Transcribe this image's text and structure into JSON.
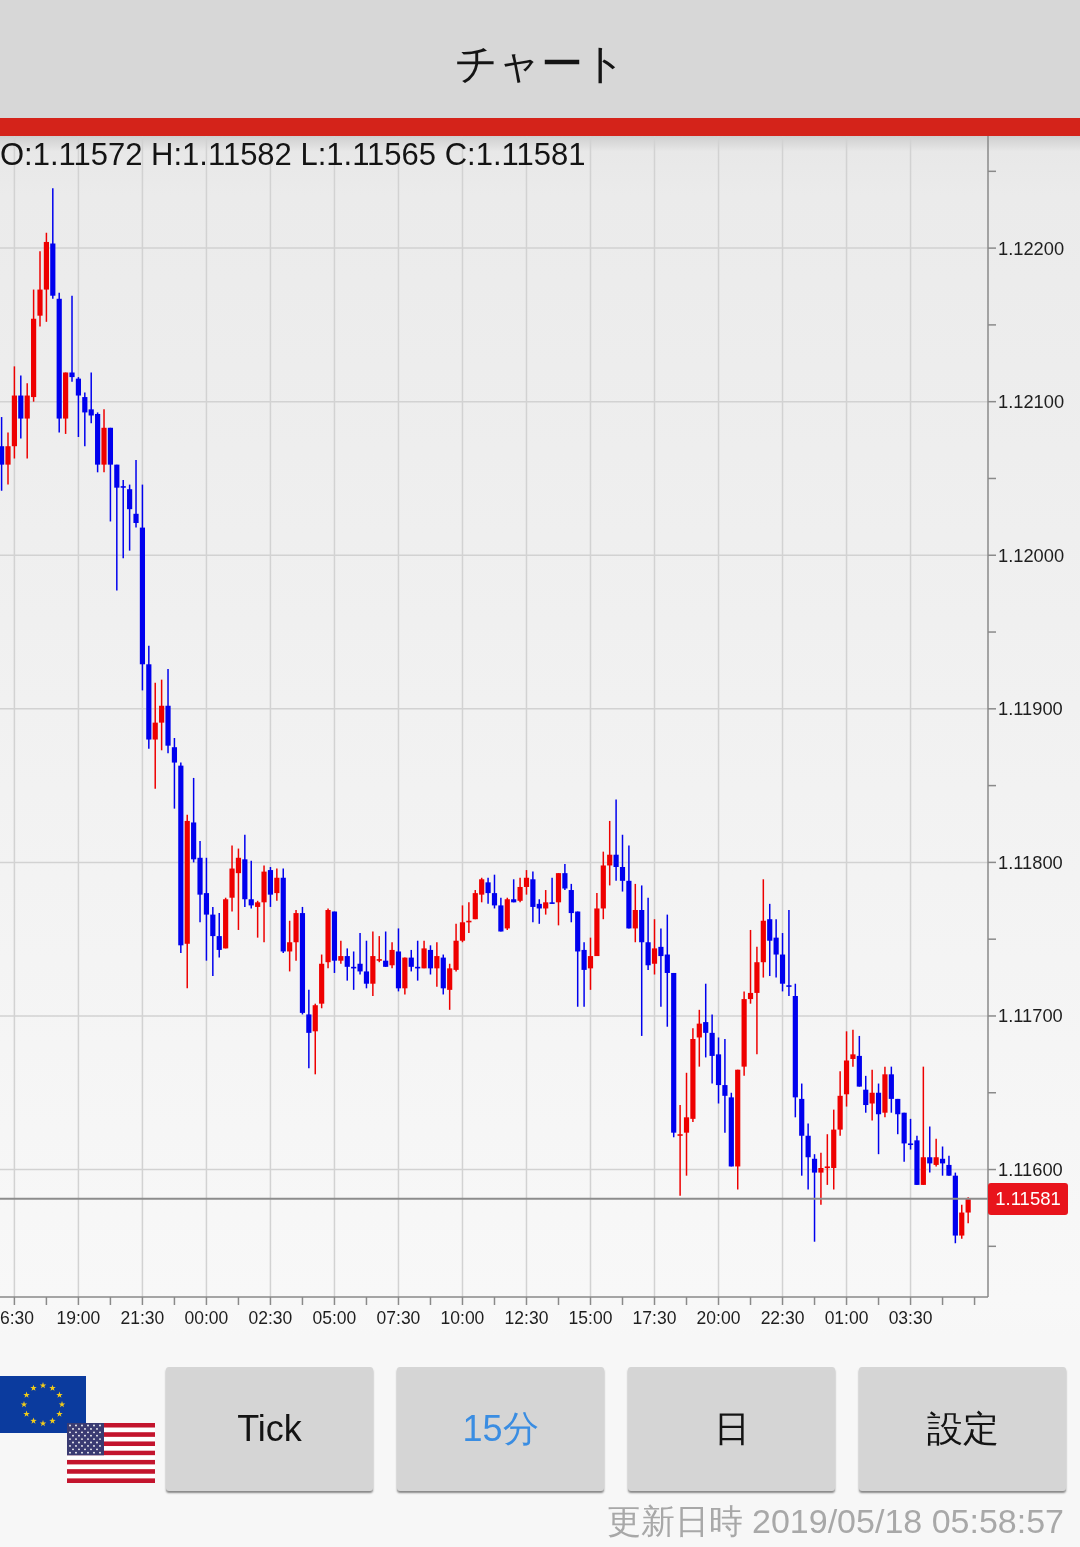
{
  "header": {
    "title": "チャート"
  },
  "chart": {
    "ohlc_readout": "O:1.11572 H:1.11582 L:1.11565 C:1.11581",
    "chart_data": {
      "type": "candlestick",
      "grid": true,
      "categories": [
        null,
        null,
        "6:30",
        null,
        null,
        null,
        null,
        null,
        null,
        null,
        null,
        null,
        "19:00",
        null,
        null,
        null,
        null,
        null,
        null,
        null,
        null,
        null,
        "21:30",
        null,
        null,
        null,
        null,
        null,
        null,
        null,
        null,
        null,
        "00:00",
        null,
        null,
        null,
        null,
        null,
        null,
        null,
        null,
        null,
        "02:30",
        null,
        null,
        null,
        null,
        null,
        null,
        null,
        null,
        null,
        "05:00",
        null,
        null,
        null,
        null,
        null,
        null,
        null,
        null,
        null,
        "07:30",
        null,
        null,
        null,
        null,
        null,
        null,
        null,
        null,
        null,
        "10:00",
        null,
        null,
        null,
        null,
        null,
        null,
        null,
        null,
        null,
        "12:30",
        null,
        null,
        null,
        null,
        null,
        null,
        null,
        null,
        null,
        "15:00",
        null,
        null,
        null,
        null,
        null,
        null,
        null,
        null,
        null,
        "17:30",
        null,
        null,
        null,
        null,
        null,
        null,
        null,
        null,
        null,
        "20:00",
        null,
        null,
        null,
        null,
        null,
        null,
        null,
        null,
        null,
        "22:30",
        null,
        null,
        null,
        null,
        null,
        null,
        null,
        null,
        null,
        "01:00",
        null,
        null,
        null,
        null,
        null,
        null,
        null,
        null,
        null,
        "03:30",
        null,
        null,
        null,
        null,
        null,
        null,
        null,
        null,
        null
      ],
      "ohlc": [
        [
          1.12071,
          1.1209,
          1.12042,
          1.12059
        ],
        [
          1.12059,
          1.1208,
          1.12046,
          1.12071
        ],
        [
          1.12071,
          1.12123,
          1.12063,
          1.12104
        ],
        [
          1.12104,
          1.12117,
          1.12076,
          1.12089
        ],
        [
          1.12089,
          1.12112,
          1.12063,
          1.12104
        ],
        [
          1.12103,
          1.12173,
          1.121,
          1.12154
        ],
        [
          1.12156,
          1.12198,
          1.12149,
          1.12173
        ],
        [
          1.12173,
          1.1221,
          1.12152,
          1.12204
        ],
        [
          1.12203,
          1.12239,
          1.12167,
          1.12169
        ],
        [
          1.12167,
          1.12171,
          1.1208,
          1.12089
        ],
        [
          1.12089,
          1.12119,
          1.12079,
          1.12119
        ],
        [
          1.12119,
          1.12169,
          1.12113,
          1.12116
        ],
        [
          1.12115,
          1.12116,
          1.12077,
          1.12104
        ],
        [
          1.12103,
          1.12106,
          1.12071,
          1.12093
        ],
        [
          1.12095,
          1.12119,
          1.12086,
          1.12091
        ],
        [
          1.12092,
          1.12093,
          1.12054,
          1.12059
        ],
        [
          1.12059,
          1.12095,
          1.12054,
          1.12083
        ],
        [
          1.12083,
          1.12083,
          1.12022,
          1.12059
        ],
        [
          1.12059,
          1.12059,
          1.11977,
          1.12044
        ],
        [
          1.12045,
          1.12049,
          1.11998,
          1.12044
        ],
        [
          1.12043,
          1.12046,
          1.12003,
          1.1203
        ],
        [
          1.12027,
          1.12062,
          1.12018,
          1.12021
        ],
        [
          1.12018,
          1.12046,
          1.11912,
          1.11929
        ],
        [
          1.11929,
          1.11941,
          1.11874,
          1.1188
        ],
        [
          1.1188,
          1.11917,
          1.11848,
          1.11891
        ],
        [
          1.11891,
          1.11919,
          1.11873,
          1.11902
        ],
        [
          1.11902,
          1.11926,
          1.11871,
          1.11876
        ],
        [
          1.11875,
          1.11881,
          1.11835,
          1.11865
        ],
        [
          1.11863,
          1.11865,
          1.11741,
          1.11746
        ],
        [
          1.11747,
          1.11831,
          1.11718,
          1.11827
        ],
        [
          1.11826,
          1.11855,
          1.118,
          1.11802
        ],
        [
          1.11803,
          1.11814,
          1.11761,
          1.11779
        ],
        [
          1.1178,
          1.11803,
          1.11736,
          1.11766
        ],
        [
          1.11766,
          1.11771,
          1.11726,
          1.11752
        ],
        [
          1.11752,
          1.11767,
          1.11738,
          1.11743
        ],
        [
          1.11744,
          1.11777,
          1.11744,
          1.11776
        ],
        [
          1.11777,
          1.11811,
          1.11768,
          1.11796
        ],
        [
          1.11793,
          1.11809,
          1.11756,
          1.11803
        ],
        [
          1.11802,
          1.11818,
          1.11771,
          1.11776
        ],
        [
          1.11776,
          1.11801,
          1.1177,
          1.11772
        ],
        [
          1.11771,
          1.11775,
          1.11751,
          1.11774
        ],
        [
          1.11774,
          1.11798,
          1.11748,
          1.11794
        ],
        [
          1.11795,
          1.11797,
          1.11771,
          1.11779
        ],
        [
          1.1178,
          1.11796,
          1.11775,
          1.1179
        ],
        [
          1.1179,
          1.11796,
          1.11741,
          1.11742
        ],
        [
          1.11742,
          1.11762,
          1.11729,
          1.11748
        ],
        [
          1.11748,
          1.11769,
          1.11736,
          1.11767
        ],
        [
          1.11767,
          1.11771,
          1.11701,
          1.11702
        ],
        [
          1.11701,
          1.11717,
          1.11666,
          1.11689
        ],
        [
          1.1169,
          1.11708,
          1.11662,
          1.11707
        ],
        [
          1.11708,
          1.1174,
          1.11705,
          1.11734
        ],
        [
          1.11735,
          1.1177,
          1.11731,
          1.11769
        ],
        [
          1.11768,
          1.11768,
          1.11728,
          1.11736
        ],
        [
          1.11736,
          1.11749,
          1.11734,
          1.11739
        ],
        [
          1.11739,
          1.11744,
          1.11723,
          1.11732
        ],
        [
          1.11732,
          1.11742,
          1.11717,
          1.11731
        ],
        [
          1.11734,
          1.11754,
          1.11727,
          1.11729
        ],
        [
          1.11729,
          1.11749,
          1.11718,
          1.11721
        ],
        [
          1.11721,
          1.11755,
          1.11713,
          1.11739
        ],
        [
          1.11736,
          1.11752,
          1.11735,
          1.11737
        ],
        [
          1.11736,
          1.11755,
          1.11732,
          1.11732
        ],
        [
          1.11733,
          1.11748,
          1.11731,
          1.11743
        ],
        [
          1.11742,
          1.11757,
          1.11716,
          1.11718
        ],
        [
          1.11718,
          1.11738,
          1.11714,
          1.11738
        ],
        [
          1.11738,
          1.11743,
          1.11729,
          1.11732
        ],
        [
          1.11732,
          1.11749,
          1.11723,
          1.11731
        ],
        [
          1.11731,
          1.11749,
          1.11731,
          1.11744
        ],
        [
          1.11743,
          1.11746,
          1.11727,
          1.11731
        ],
        [
          1.11731,
          1.11748,
          1.11719,
          1.11739
        ],
        [
          1.11738,
          1.1174,
          1.11714,
          1.11718
        ],
        [
          1.11717,
          1.11734,
          1.11704,
          1.11731
        ],
        [
          1.1173,
          1.1176,
          1.11729,
          1.11749
        ],
        [
          1.11749,
          1.11772,
          1.11748,
          1.11761
        ],
        [
          1.11761,
          1.11774,
          1.11754,
          1.11762
        ],
        [
          1.11763,
          1.11782,
          1.11763,
          1.1178
        ],
        [
          1.11779,
          1.1179,
          1.11774,
          1.11789
        ],
        [
          1.11787,
          1.1179,
          1.11773,
          1.1178
        ],
        [
          1.1178,
          1.11792,
          1.1177,
          1.11772
        ],
        [
          1.11772,
          1.11777,
          1.11755,
          1.11755
        ],
        [
          1.11757,
          1.11777,
          1.11756,
          1.11776
        ],
        [
          1.11776,
          1.11789,
          1.11774,
          1.11774
        ],
        [
          1.11775,
          1.1179,
          1.11774,
          1.11784
        ],
        [
          1.11784,
          1.11795,
          1.11779,
          1.1179
        ],
        [
          1.11789,
          1.11794,
          1.11761,
          1.11771
        ],
        [
          1.11773,
          1.11776,
          1.1176,
          1.1177
        ],
        [
          1.1177,
          1.11782,
          1.11766,
          1.11774
        ],
        [
          1.11774,
          1.1179,
          1.11773,
          1.11773
        ],
        [
          1.11774,
          1.11793,
          1.11759,
          1.11793
        ],
        [
          1.11793,
          1.11799,
          1.11782,
          1.11783
        ],
        [
          1.11782,
          1.11786,
          1.11761,
          1.11767
        ],
        [
          1.11768,
          1.11768,
          1.11706,
          1.11742
        ],
        [
          1.11743,
          1.11748,
          1.11706,
          1.1173
        ],
        [
          1.11731,
          1.11751,
          1.11717,
          1.11739
        ],
        [
          1.11739,
          1.1178,
          1.11739,
          1.1177
        ],
        [
          1.1177,
          1.11807,
          1.11763,
          1.11798
        ],
        [
          1.11798,
          1.11827,
          1.11785,
          1.11805
        ],
        [
          1.11805,
          1.11841,
          1.11788,
          1.11797
        ],
        [
          1.11797,
          1.11818,
          1.11781,
          1.11788
        ],
        [
          1.11788,
          1.11811,
          1.11757,
          1.11757
        ],
        [
          1.11757,
          1.11786,
          1.11748,
          1.11769
        ],
        [
          1.11769,
          1.11785,
          1.11687,
          1.11748
        ],
        [
          1.11748,
          1.11777,
          1.1173,
          1.11733
        ],
        [
          1.11734,
          1.11763,
          1.11727,
          1.11744
        ],
        [
          1.11745,
          1.11757,
          1.11706,
          1.11739
        ],
        [
          1.1174,
          1.11766,
          1.11693,
          1.11728
        ],
        [
          1.11728,
          1.11728,
          1.11621,
          1.11624
        ],
        [
          1.11622,
          1.11642,
          1.11583,
          1.11623
        ],
        [
          1.11624,
          1.11663,
          1.11596,
          1.11634
        ],
        [
          1.11633,
          1.11692,
          1.11631,
          1.11685
        ],
        [
          1.11686,
          1.11704,
          1.11667,
          1.11695
        ],
        [
          1.11696,
          1.11721,
          1.11673,
          1.11689
        ],
        [
          1.11689,
          1.11701,
          1.11656,
          1.11674
        ],
        [
          1.11675,
          1.11686,
          1.11643,
          1.11655
        ],
        [
          1.11655,
          1.11685,
          1.11624,
          1.11648
        ],
        [
          1.11647,
          1.1165,
          1.11602,
          1.11602
        ],
        [
          1.11602,
          1.11665,
          1.11587,
          1.11665
        ],
        [
          1.11667,
          1.11716,
          1.11661,
          1.11711
        ],
        [
          1.11711,
          1.11756,
          1.11708,
          1.11715
        ],
        [
          1.11715,
          1.11745,
          1.11675,
          1.11735
        ],
        [
          1.11735,
          1.11789,
          1.11725,
          1.11762
        ],
        [
          1.11763,
          1.11773,
          1.11726,
          1.11749
        ],
        [
          1.11751,
          1.11763,
          1.11725,
          1.1174
        ],
        [
          1.1174,
          1.11754,
          1.11716,
          1.11721
        ],
        [
          1.1172,
          1.11769,
          1.11713,
          1.11719
        ],
        [
          1.11713,
          1.11721,
          1.11634,
          1.11647
        ],
        [
          1.11646,
          1.11656,
          1.11596,
          1.11622
        ],
        [
          1.11622,
          1.1163,
          1.11587,
          1.11608
        ],
        [
          1.11607,
          1.1161,
          1.11553,
          1.11598
        ],
        [
          1.11598,
          1.11611,
          1.11577,
          1.11601
        ],
        [
          1.11601,
          1.11623,
          1.1159,
          1.11602
        ],
        [
          1.11601,
          1.11639,
          1.11587,
          1.11626
        ],
        [
          1.11626,
          1.11664,
          1.11622,
          1.11648
        ],
        [
          1.11649,
          1.1169,
          1.11641,
          1.11671
        ],
        [
          1.11672,
          1.11691,
          1.11667,
          1.11675
        ],
        [
          1.11674,
          1.11687,
          1.11654,
          1.11654
        ],
        [
          1.11652,
          1.11661,
          1.11637,
          1.11642
        ],
        [
          1.11643,
          1.11665,
          1.11632,
          1.1165
        ],
        [
          1.1165,
          1.11656,
          1.1161,
          1.11636
        ],
        [
          1.11637,
          1.11667,
          1.11634,
          1.11662
        ],
        [
          1.11662,
          1.11667,
          1.11637,
          1.11646
        ],
        [
          1.11646,
          1.11646,
          1.11623,
          1.11636
        ],
        [
          1.11637,
          1.11637,
          1.11605,
          1.11617
        ],
        [
          1.11617,
          1.11633,
          1.11613,
          1.11616
        ],
        [
          1.11619,
          1.11622,
          1.1159,
          1.1159
        ],
        [
          1.1159,
          1.11667,
          1.1159,
          1.11608
        ],
        [
          1.11608,
          1.11628,
          1.11598,
          1.11604
        ],
        [
          1.11603,
          1.1162,
          1.11602,
          1.11608
        ],
        [
          1.11607,
          1.11615,
          1.11596,
          1.11604
        ],
        [
          1.11603,
          1.11609,
          1.11596,
          1.11596
        ],
        [
          1.11596,
          1.11598,
          1.11552,
          1.11557
        ],
        [
          1.11557,
          1.11577,
          1.11555,
          1.11572
        ],
        [
          1.11572,
          1.11582,
          1.11565,
          1.11581
        ]
      ],
      "ylim": [
        1.11517,
        1.12273
      ],
      "yticks": [
        {
          "value": 1.122,
          "label": "1.12200"
        },
        {
          "value": 1.121,
          "label": "1.12100"
        },
        {
          "value": 1.12,
          "label": "1.12000"
        },
        {
          "value": 1.119,
          "label": "1.11900"
        },
        {
          "value": 1.118,
          "label": "1.11800"
        },
        {
          "value": 1.117,
          "label": "1.11700"
        },
        {
          "value": 1.116,
          "label": "1.11600"
        }
      ],
      "ref_lines": [
        {
          "axis": "y",
          "value": 1.11581,
          "label": "1.11581"
        }
      ]
    }
  },
  "buttons": [
    {
      "label": "Tick",
      "selected": false
    },
    {
      "label": "15分",
      "selected": true
    },
    {
      "label": "日",
      "selected": false
    },
    {
      "label": "設定",
      "selected": false
    }
  ],
  "updated": "更新日時 2019/05/18 05:58:57"
}
